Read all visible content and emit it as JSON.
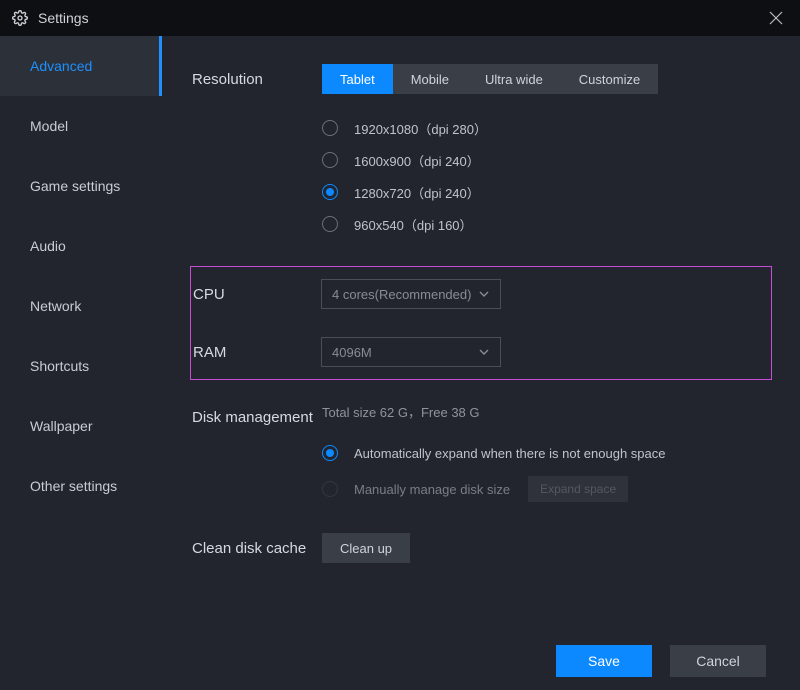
{
  "titlebar": {
    "title": "Settings"
  },
  "sidebar": {
    "items": [
      {
        "label": "Advanced",
        "active": true
      },
      {
        "label": "Model"
      },
      {
        "label": "Game settings"
      },
      {
        "label": "Audio"
      },
      {
        "label": "Network"
      },
      {
        "label": "Shortcuts"
      },
      {
        "label": "Wallpaper"
      },
      {
        "label": "Other settings"
      }
    ]
  },
  "resolution": {
    "label": "Resolution",
    "tabs": [
      {
        "label": "Tablet",
        "active": true
      },
      {
        "label": "Mobile"
      },
      {
        "label": "Ultra wide"
      },
      {
        "label": "Customize"
      }
    ],
    "options": [
      {
        "label": "1920x1080（dpi 280）",
        "selected": false
      },
      {
        "label": "1600x900（dpi 240）",
        "selected": false
      },
      {
        "label": "1280x720（dpi 240）",
        "selected": true
      },
      {
        "label": "960x540（dpi 160）",
        "selected": false
      }
    ]
  },
  "cpu": {
    "label": "CPU",
    "value": "4 cores(Recommended)"
  },
  "ram": {
    "label": "RAM",
    "value": "4096M"
  },
  "disk": {
    "label": "Disk management",
    "info": "Total size 62 G，Free 38 G",
    "auto_label": "Automatically expand when there is not enough space",
    "manual_label": "Manually manage disk size",
    "expand_label": "Expand space",
    "selected": "auto"
  },
  "clean": {
    "label": "Clean disk cache",
    "button": "Clean up"
  },
  "footer": {
    "save": "Save",
    "cancel": "Cancel"
  }
}
